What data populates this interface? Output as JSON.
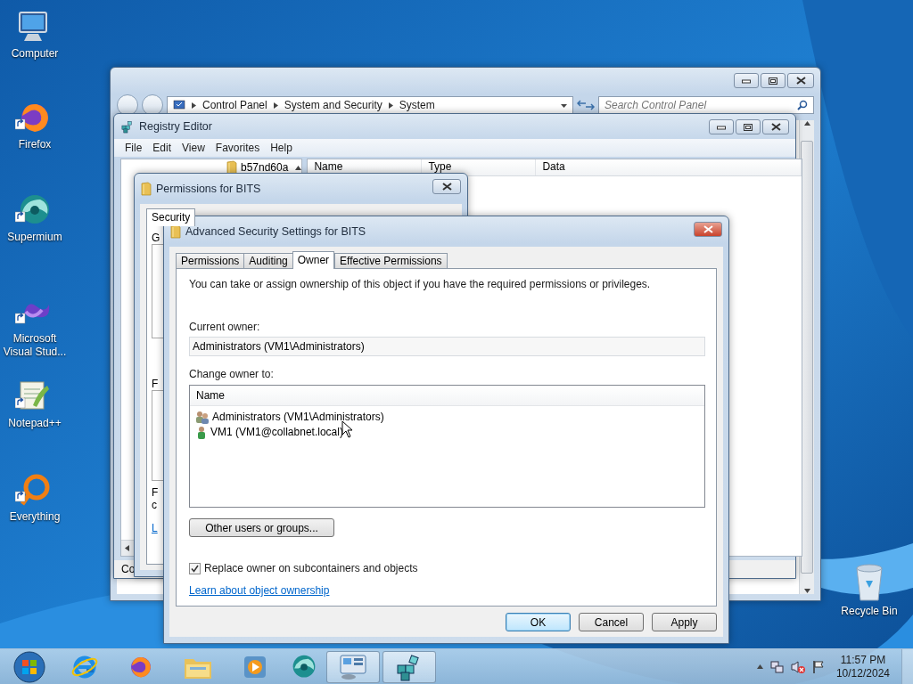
{
  "desktop_icons": [
    {
      "label": "Computer",
      "kind": "computer",
      "shortcut": false
    },
    {
      "label": "Firefox",
      "kind": "firefox",
      "shortcut": true
    },
    {
      "label": "Supermium",
      "kind": "supermium",
      "shortcut": true
    },
    {
      "label": "Microsoft Visual Stud...",
      "kind": "visual-studio",
      "shortcut": true
    },
    {
      "label": "Notepad++",
      "kind": "notepad",
      "shortcut": true
    },
    {
      "label": "Everything",
      "kind": "everything",
      "shortcut": true
    }
  ],
  "recycle_bin": {
    "label": "Recycle Bin"
  },
  "control_panel": {
    "breadcrumb": [
      "Control Panel",
      "System and Security",
      "System"
    ],
    "search": {
      "placeholder": "Search Control Panel"
    }
  },
  "registry_editor": {
    "title": "Registry Editor",
    "menu": [
      "File",
      "Edit",
      "View",
      "Favorites",
      "Help"
    ],
    "tree_item": "b57nd60a",
    "columns": [
      "Name",
      "Type",
      "Data"
    ],
    "status_bar": "Co"
  },
  "permissions_dialog": {
    "title": "Permissions for BITS",
    "tabs": [
      {
        "label": "Security",
        "selected": true
      }
    ],
    "fragments": [
      "G",
      "F",
      "F",
      "c",
      "L"
    ]
  },
  "advanced_dialog": {
    "title": "Advanced Security Settings for BITS",
    "tabs": [
      {
        "label": "Permissions",
        "selected": false
      },
      {
        "label": "Auditing",
        "selected": false
      },
      {
        "label": "Owner",
        "selected": true
      },
      {
        "label": "Effective Permissions",
        "selected": false
      }
    ],
    "intro": "You can take or assign ownership of this object if you have the required permissions or privileges.",
    "current_owner_label": "Current owner:",
    "current_owner": "Administrators (VM1\\Administrators)",
    "change_owner_label": "Change owner to:",
    "owner_list": {
      "column": "Name",
      "items": [
        {
          "name": "Administrators (VM1\\Administrators)",
          "kind": "group"
        },
        {
          "name": "VM1 (VM1@collabnet.local)",
          "kind": "user"
        }
      ]
    },
    "other_button": "Other users or groups...",
    "replace_checkbox": {
      "label": "Replace owner on subcontainers and objects",
      "checked": true
    },
    "link": "Learn about object ownership",
    "buttons": [
      {
        "label": "OK",
        "default": true
      },
      {
        "label": "Cancel",
        "default": false
      },
      {
        "label": "Apply",
        "default": false
      }
    ]
  },
  "taskbar": {
    "items": [
      {
        "kind": "start",
        "active": false
      },
      {
        "kind": "ie",
        "active": false
      },
      {
        "kind": "firefox",
        "active": false
      },
      {
        "kind": "explorer",
        "active": false
      },
      {
        "kind": "media",
        "active": false
      },
      {
        "kind": "supermium",
        "active": false
      },
      {
        "kind": "control-panel",
        "active": true
      },
      {
        "kind": "registry",
        "active": true
      }
    ],
    "tray": {
      "time": "11:57 PM",
      "date": "10/12/2024"
    }
  }
}
